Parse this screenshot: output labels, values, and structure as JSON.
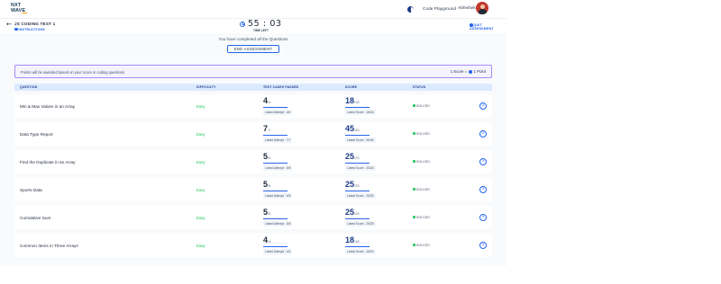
{
  "header": {
    "logo_line1": "NXT",
    "logo_line2": "WAVE",
    "code_playground": "Code Playground",
    "user_name": "Abhishek"
  },
  "subheader": {
    "test_title": "JS CODING TEST 1",
    "instructions_label": "INSTRUCTIONS",
    "timer": "55 : 03",
    "time_left_label": "TIME LEFT",
    "exit_label": "QUIT ASSESSMENT",
    "progress_fraction": 0.61
  },
  "main": {
    "completed_message": "You have completed all the Questions",
    "end_button_label": "END ASSESSMENT",
    "info_text": "Points will be awarded based on your score in coding questions",
    "points_rule_left": "1 Score = ",
    "points_rule_right": " 1 Point"
  },
  "table": {
    "headers": {
      "question": "QUESTION",
      "difficulty": "DIFFICULTY",
      "test_cases": "TEST CASES PASSED",
      "score": "SCORE",
      "status": "STATUS"
    },
    "rows": [
      {
        "question": "Min & Max Values in an Array",
        "difficulty": "Easy",
        "tc_passed": "4",
        "tc_total": "/4",
        "tc_latest": "Latest Attempt : 4/4",
        "score": "18",
        "score_total": "/18",
        "score_latest": "Latest Score : 18/18",
        "status": "SOLVED"
      },
      {
        "question": "Data Type Report",
        "difficulty": "Easy",
        "tc_passed": "7",
        "tc_total": "/7",
        "tc_latest": "Latest Attempt : 7/7",
        "score": "45",
        "score_total": "/45",
        "score_latest": "Latest Score : 45/45",
        "status": "SOLVED"
      },
      {
        "question": "Find the Duplicate in an Array",
        "difficulty": "Easy",
        "tc_passed": "5",
        "tc_total": "/5",
        "tc_latest": "Latest Attempt : 5/5",
        "score": "25",
        "score_total": "/25",
        "score_latest": "Latest Score : 25/25",
        "status": "SOLVED"
      },
      {
        "question": "Sports Data",
        "difficulty": "Easy",
        "tc_passed": "5",
        "tc_total": "/5",
        "tc_latest": "Latest Attempt : 5/5",
        "score": "25",
        "score_total": "/25",
        "score_latest": "Latest Score : 25/25",
        "status": "SOLVED"
      },
      {
        "question": "Cumulative Sum",
        "difficulty": "Easy",
        "tc_passed": "5",
        "tc_total": "/5",
        "tc_latest": "Latest Attempt : 5/5",
        "score": "25",
        "score_total": "/25",
        "score_latest": "Latest Score : 25/25",
        "status": "SOLVED"
      },
      {
        "question": "Common Items in Three Arrays",
        "difficulty": "Easy",
        "tc_passed": "4",
        "tc_total": "/4",
        "tc_latest": "Latest Attempt : 4/4",
        "score": "18",
        "score_total": "/18",
        "score_latest": "Latest Score : 18/18",
        "status": "SOLVED"
      }
    ]
  },
  "colors": {
    "accent": "#2563eb",
    "easy": "#22c55e",
    "solved_dot": "#22c55e",
    "banner_border": "#a78bfa"
  }
}
